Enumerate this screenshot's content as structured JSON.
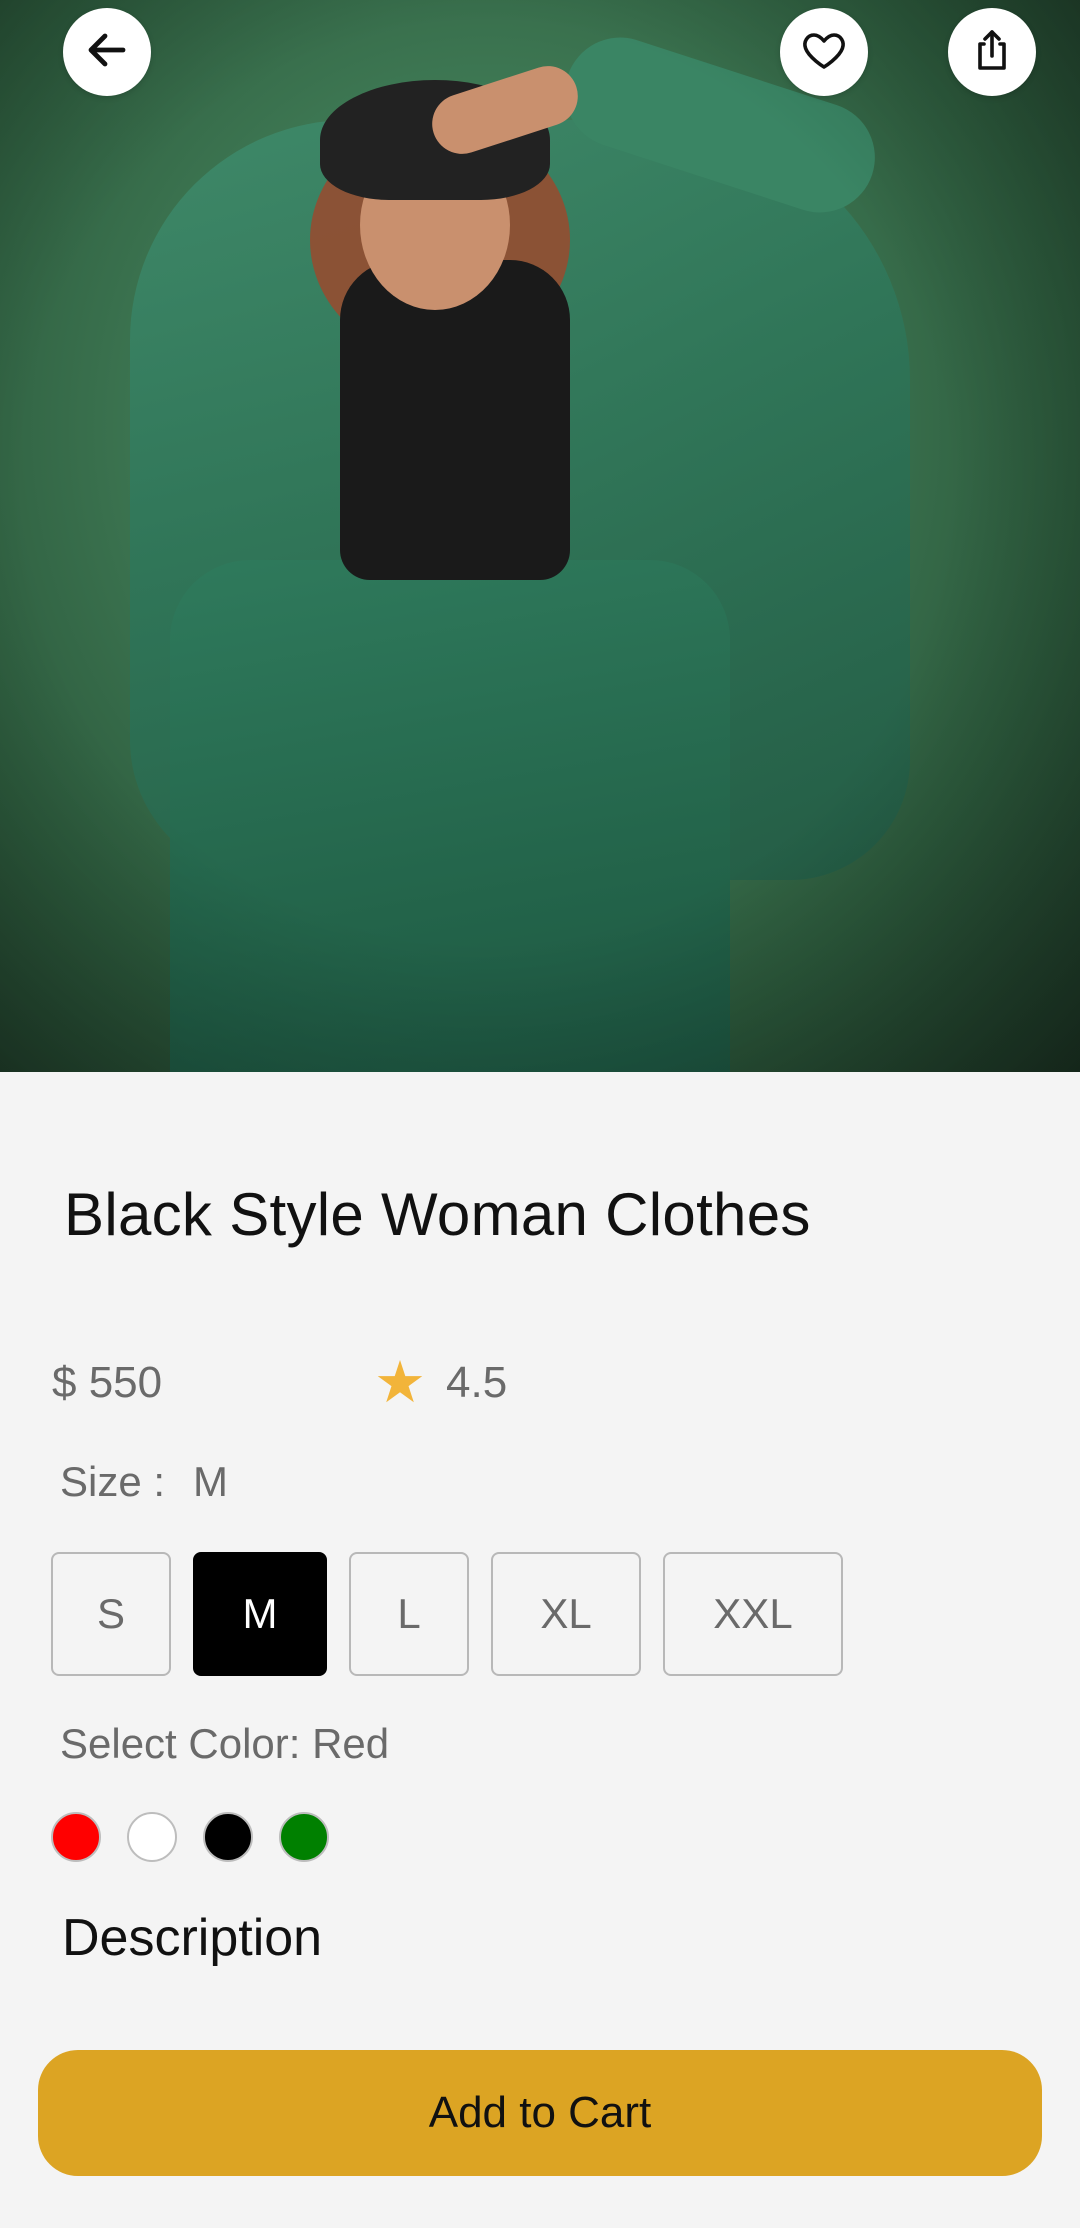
{
  "product": {
    "title": "Black Style Woman Clothes",
    "price": "$ 550",
    "rating": "4.5",
    "image": {
      "description": "product-photo",
      "background_color": "#3f7a55"
    }
  },
  "size": {
    "label": "Size :",
    "selected": "M",
    "options": [
      "S",
      "M",
      "L",
      "XL",
      "XXL"
    ]
  },
  "color": {
    "label": "Select Color: Red",
    "options": [
      {
        "name": "red",
        "hex": "#ff0000"
      },
      {
        "name": "white",
        "hex": "#ffffff"
      },
      {
        "name": "black",
        "hex": "#000000"
      },
      {
        "name": "green",
        "hex": "#008000"
      }
    ]
  },
  "description": {
    "heading": "Description"
  },
  "actions": {
    "add_to_cart": "Add to Cart"
  },
  "icons": {
    "back": "arrow-left-icon",
    "favorite": "heart-icon",
    "share": "share-icon",
    "rating": "star-icon"
  },
  "colors": {
    "accent": "#dca423",
    "star": "#f2b43a",
    "background": "#f4f4f4",
    "selected_size": "#000000"
  }
}
